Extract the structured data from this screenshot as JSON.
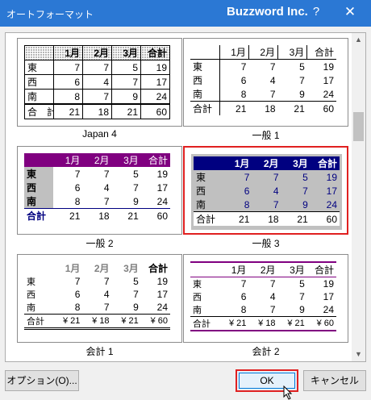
{
  "window": {
    "title": "オートフォーマット",
    "brand": "Buzzword Inc.",
    "help": "?",
    "close": "✕"
  },
  "formats": [
    {
      "name": "Japan 4",
      "header": [
        "",
        "1月",
        "2月",
        "3月",
        "合計"
      ],
      "rows": [
        [
          "東",
          "7",
          "7",
          "5",
          "19"
        ],
        [
          "西",
          "6",
          "4",
          "7",
          "17"
        ],
        [
          "南",
          "8",
          "7",
          "9",
          "24"
        ]
      ],
      "total": [
        "合　計",
        "21",
        "18",
        "21",
        "60"
      ]
    },
    {
      "name": "一般 1",
      "header": [
        "",
        "1月",
        "2月",
        "3月",
        "合計"
      ],
      "rows": [
        [
          "東",
          "7",
          "7",
          "5",
          "19"
        ],
        [
          "西",
          "6",
          "4",
          "7",
          "17"
        ],
        [
          "南",
          "8",
          "7",
          "9",
          "24"
        ]
      ],
      "total": [
        "合計",
        "21",
        "18",
        "21",
        "60"
      ]
    },
    {
      "name": "一般 2",
      "header": [
        "",
        "1月",
        "2月",
        "3月",
        "合計"
      ],
      "rows": [
        [
          "東",
          "7",
          "7",
          "5",
          "19"
        ],
        [
          "西",
          "6",
          "4",
          "7",
          "17"
        ],
        [
          "南",
          "8",
          "7",
          "9",
          "24"
        ]
      ],
      "total": [
        "合計",
        "21",
        "18",
        "21",
        "60"
      ]
    },
    {
      "name": "一般 3",
      "header": [
        "",
        "1月",
        "2月",
        "3月",
        "合計"
      ],
      "rows": [
        [
          "東",
          "7",
          "7",
          "5",
          "19"
        ],
        [
          "西",
          "6",
          "4",
          "7",
          "17"
        ],
        [
          "南",
          "8",
          "7",
          "9",
          "24"
        ]
      ],
      "total": [
        "合計",
        "21",
        "18",
        "21",
        "60"
      ],
      "selected": true
    },
    {
      "name": "会計 1",
      "header": [
        "",
        "1月",
        "2月",
        "3月",
        "合計"
      ],
      "rows": [
        [
          "東",
          "7",
          "7",
          "5",
          "19"
        ],
        [
          "西",
          "6",
          "4",
          "7",
          "17"
        ],
        [
          "南",
          "8",
          "7",
          "9",
          "24"
        ]
      ],
      "total": [
        "合計",
        "¥ 21",
        "¥ 18",
        "¥ 21",
        "¥ 60"
      ]
    },
    {
      "name": "会計 2",
      "header": [
        "",
        "1月",
        "2月",
        "3月",
        "合計"
      ],
      "rows": [
        [
          "東",
          "7",
          "7",
          "5",
          "19"
        ],
        [
          "西",
          "6",
          "4",
          "7",
          "17"
        ],
        [
          "南",
          "8",
          "7",
          "9",
          "24"
        ]
      ],
      "total": [
        "合計",
        "¥ 21",
        "¥ 18",
        "¥ 21",
        "¥ 60"
      ]
    }
  ],
  "buttons": {
    "options": "オプション(O)...",
    "ok": "OK",
    "cancel": "キャンセル"
  },
  "scrollbar": {
    "up": "▲",
    "down": "▼"
  }
}
